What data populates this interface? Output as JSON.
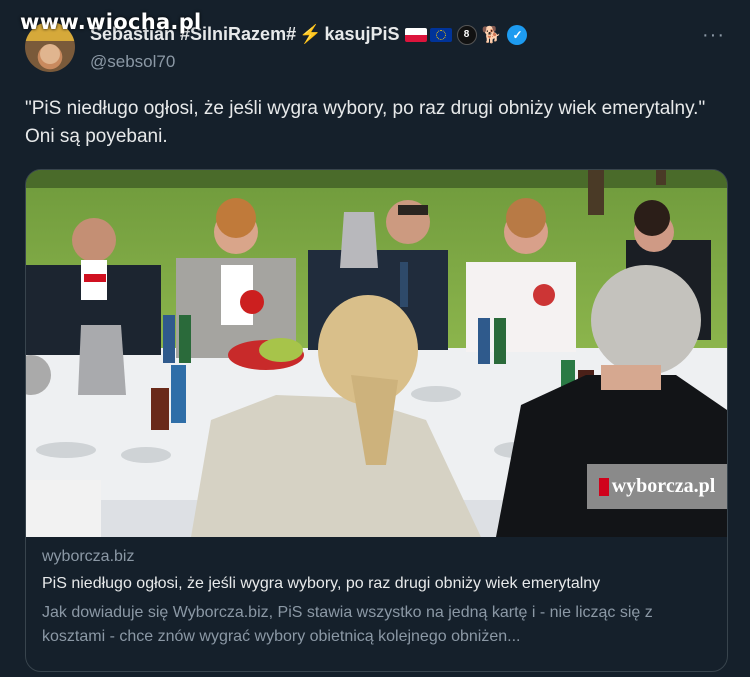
{
  "watermark": "www.wiocha.pl",
  "author": {
    "name": "Sebastian #SilniRazem#",
    "name_suffix": "kasujPiS",
    "bolt": "⚡",
    "ball": "8",
    "dog": "🐕",
    "handle": "@sebsol70"
  },
  "more_label": "···",
  "tweet": {
    "text": "\"PiS niedługo ogłosi, że jeśli wygra wybory, po raz drugi obniży wiek emerytalny.\" Oni są poyebani."
  },
  "card": {
    "badge_text": "wyborcza.pl",
    "domain": "wyborcza.biz",
    "title": "PiS niedługo ogłosi, że jeśli wygra wybory, po raz drugi obniży wiek emerytalny",
    "description": "Jak dowiaduje się Wyborcza.biz, PiS stawia wszystko na jedną kartę i - nie licząc się z kosztami - chce znów wygrać wybory obietnicą kolejnego obniżen..."
  },
  "colors": {
    "background": "#15202b",
    "text": "#e7e9ea",
    "secondary_text": "#8b98a5",
    "verified": "#1d9bf0",
    "border": "#38444d"
  }
}
